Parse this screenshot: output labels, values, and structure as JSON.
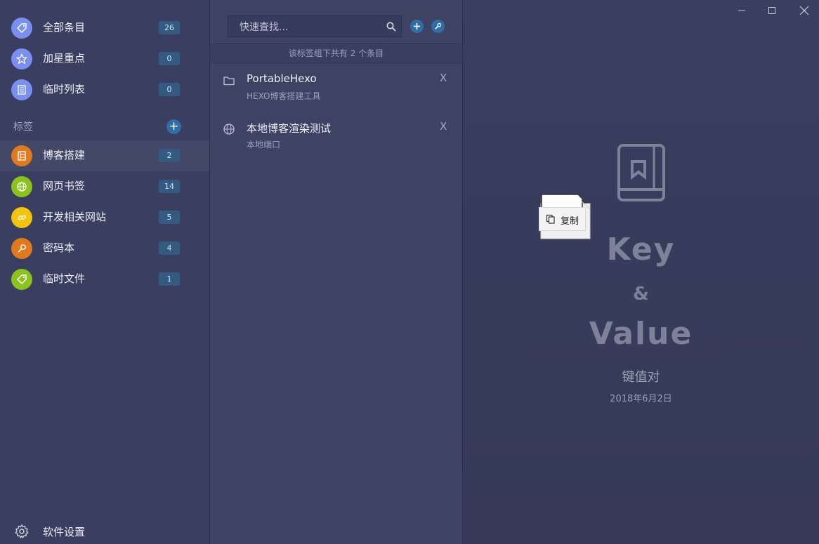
{
  "sidebar": {
    "items": [
      {
        "label": "全部条目",
        "count": "26",
        "icon": "tag-icon",
        "color": "#7b8ff0"
      },
      {
        "label": "加星重点",
        "count": "0",
        "icon": "star-icon",
        "color": "#7b8ff0"
      },
      {
        "label": "临时列表",
        "count": "0",
        "icon": "list-icon",
        "color": "#7b8ff0"
      }
    ],
    "tags_header": "标签",
    "tag_add": "+",
    "tags": [
      {
        "label": "博客搭建",
        "count": "2",
        "icon": "film-icon",
        "color": "#e07a1f",
        "active": true
      },
      {
        "label": "网页书签",
        "count": "14",
        "icon": "globe-icon",
        "color": "#8cc21e"
      },
      {
        "label": "开发相关网站",
        "count": "5",
        "icon": "link-icon",
        "color": "#f2c40c"
      },
      {
        "label": "密码本",
        "count": "4",
        "icon": "key-icon",
        "color": "#e07a1f"
      },
      {
        "label": "临时文件",
        "count": "1",
        "icon": "tag-icon",
        "color": "#8cc21e"
      }
    ],
    "settings_label": "软件设置"
  },
  "middle": {
    "search_placeholder": "快速查找...",
    "summary": "该标签组下共有 2 个条目",
    "entries": [
      {
        "title": "PortableHexo",
        "subtitle": "HEXO博客搭建工具",
        "icon": "folder-icon",
        "close": "X"
      },
      {
        "title": "本地博客渲染测试",
        "subtitle": "本地端口",
        "icon": "globe-icon",
        "close": "X"
      }
    ]
  },
  "detail": {
    "key": "Key",
    "amp": "&",
    "value": "Value",
    "subtitle": "键值对",
    "date": "2018年6月2日"
  },
  "popup": {
    "copy_label": "复制"
  }
}
